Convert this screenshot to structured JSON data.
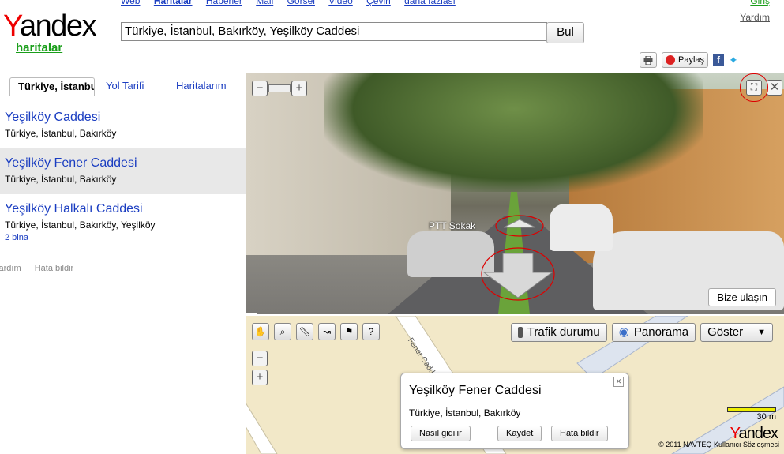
{
  "header": {
    "logo_text_y": "Y",
    "logo_text_rest": "andex",
    "logo_sub": "haritalar",
    "nav": [
      "Web",
      "Haritalar",
      "Haberler",
      "Mail",
      "Görsel",
      "Video",
      "Çeviri",
      "daha fazlası"
    ],
    "login": "Giriş",
    "help": "Yardım",
    "search_value": "Türkiye, İstanbul, Bakırköy, Yeşilköy Caddesi",
    "search_button": "Bul",
    "share_label": "Paylaş"
  },
  "left": {
    "tabs": [
      "Türkiye, İstanbul",
      "Yol Tarifi",
      "Haritalarım"
    ],
    "results": [
      {
        "title": "Yeşilköy Caddesi",
        "addr": "Türkiye, İstanbul, Bakırköy"
      },
      {
        "title": "Yeşilköy Fener Caddesi",
        "addr": "Türkiye, İstanbul, Bakırköy"
      },
      {
        "title": "Yeşilköy Halkalı Caddesi",
        "addr": "Türkiye, İstanbul, Bakırköy, Yeşilköy",
        "extra": "2 bina"
      }
    ],
    "links": [
      "Yardım",
      "Hata bildir"
    ]
  },
  "panorama": {
    "street_label": "PTT Sokak",
    "contact_button": "Bize ulaşın"
  },
  "map": {
    "street_label": "Fener Caddesi",
    "buttons": {
      "traffic": "Trafik durumu",
      "panorama": "Panorama",
      "show": "Göster"
    },
    "popup": {
      "title": "Yeşilköy Fener Caddesi",
      "addr": "Türkiye, İstanbul, Bakırköy",
      "btn_route": "Nasıl gidilir",
      "btn_save": "Kaydet",
      "btn_report": "Hata bildir"
    },
    "scale": "30 m",
    "logo_y": "Y",
    "logo_rest": "andex",
    "copyright": "© 2011 NAVTEQ",
    "terms": "Kullanıcı Sözleşmesi"
  },
  "colors": {
    "link": "#1a3dc1",
    "brand_red": "#e00",
    "green": "#1a9e1a",
    "map_bg": "#f2e8c8"
  }
}
